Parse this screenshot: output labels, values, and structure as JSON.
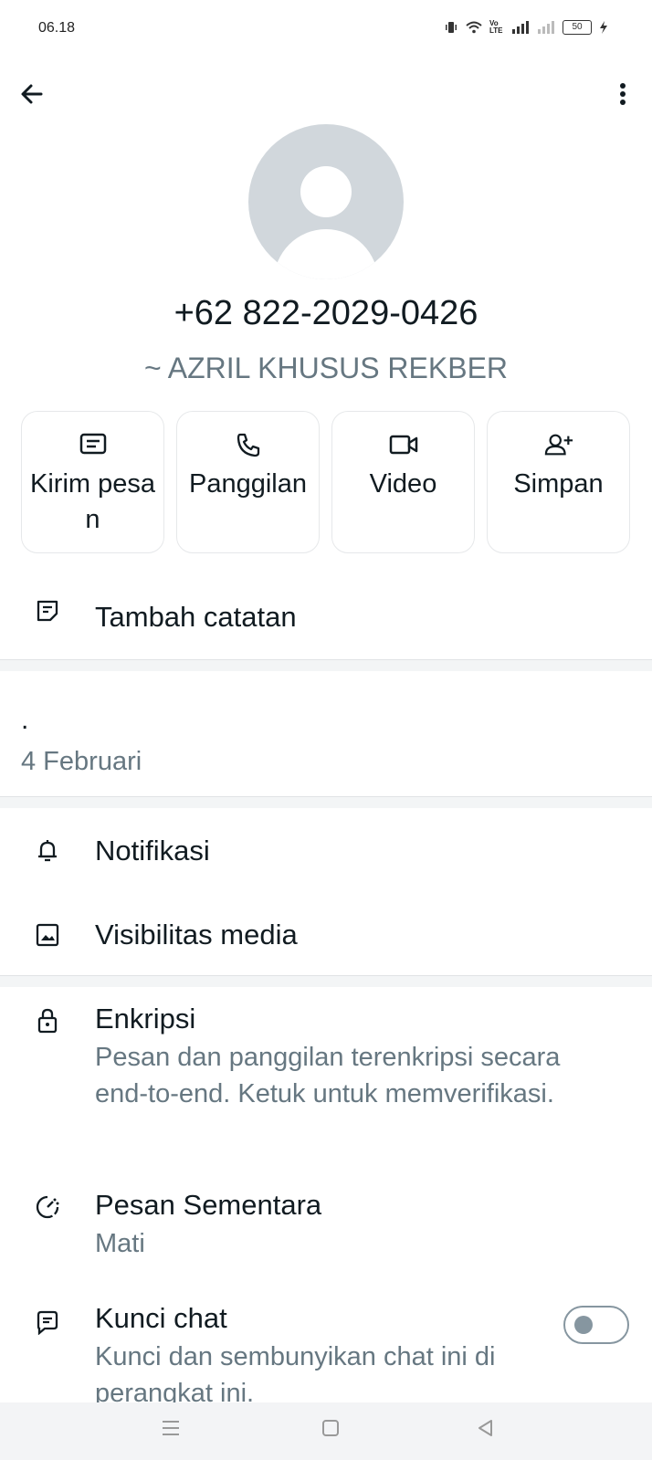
{
  "status_bar": {
    "time": "06.18",
    "battery": "50",
    "volte": "Vo LTE"
  },
  "header": {
    "back_icon": "arrow-left-icon",
    "menu_icon": "more-vert-icon"
  },
  "contact": {
    "phone": "+62 822-2029-0426",
    "alias": "~ AZRIL KHUSUS REKBER"
  },
  "actions": [
    {
      "label": "Kirim pesan",
      "icon": "message-icon"
    },
    {
      "label": "Panggilan",
      "icon": "phone-icon"
    },
    {
      "label": "Video",
      "icon": "video-icon"
    },
    {
      "label": "Simpan",
      "icon": "add-contact-icon"
    }
  ],
  "note": {
    "label": "Tambah catatan"
  },
  "about": {
    "text": ".",
    "date": "4 Februari"
  },
  "settings": {
    "notifications": "Notifikasi",
    "media_visibility": "Visibilitas media",
    "encryption_title": "Enkripsi",
    "encryption_sub": "Pesan dan panggilan terenkripsi secara end-to-end. Ketuk untuk memverifikasi.",
    "disappearing_title": "Pesan Sementara",
    "disappearing_sub": "Mati",
    "lock_title": "Kunci chat",
    "lock_sub": "Kunci dan sembunyikan chat ini di perangkat ini.",
    "lock_enabled": false
  },
  "colors": {
    "accent": "#111b21",
    "muted": "#667781",
    "avatar_bg": "#d1d7dc"
  }
}
